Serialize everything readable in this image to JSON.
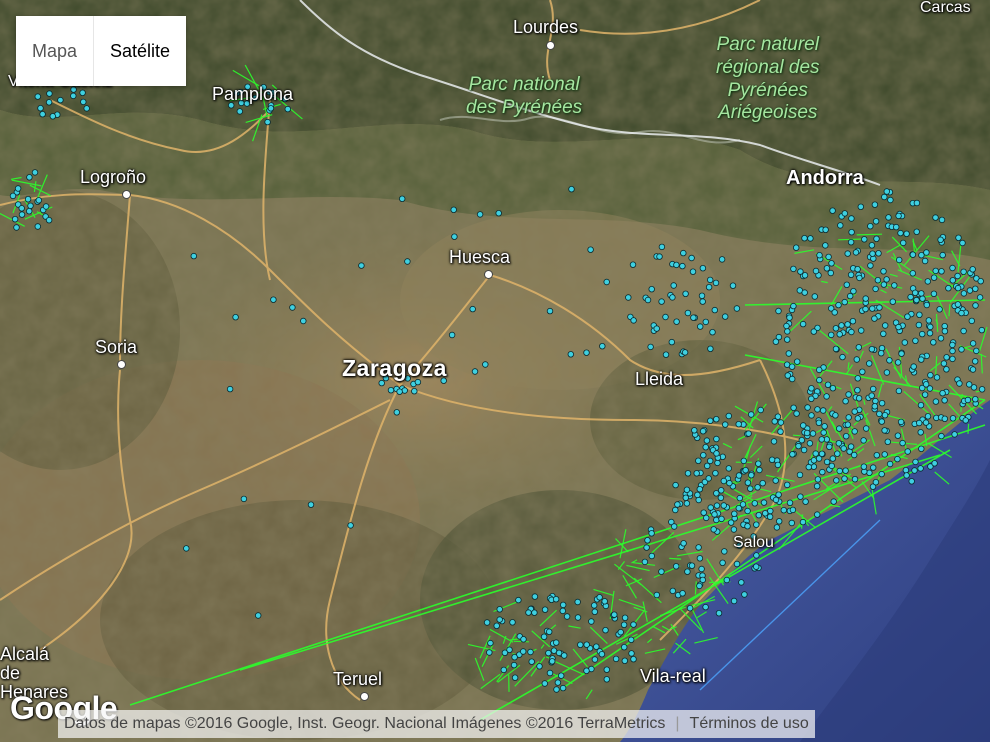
{
  "map_type": {
    "options": [
      "Mapa",
      "Satélite"
    ],
    "active": "Satélite"
  },
  "places": {
    "lourdes": "Lourdes",
    "pamplona": "Pamplona",
    "logrono": "Logroño",
    "andorra": "Andorra",
    "huesca": "Huesca",
    "soria": "Soria",
    "zaragoza": "Zaragoza",
    "lleida": "Lleida",
    "salou": "Salou",
    "teruel": "Teruel",
    "vitoria": "Vitoria-Gasteiz",
    "alcala": "Alcalá de Henares",
    "castellon": "Vila-real",
    "carcas": "Carcas"
  },
  "parks": {
    "pyrenees": [
      "Parc national",
      "des Pyrénées"
    ],
    "ariege": [
      "Parc naturel",
      "régional des",
      "Pyrénées",
      "Ariégeoises"
    ]
  },
  "attribution": {
    "data": "Datos de mapas ©2016 Google, Inst. Geogr. Nacional Imágenes ©2016 TerraMetrics",
    "terms": "Términos de uso"
  },
  "logo": "Google",
  "colors": {
    "marker_fill": "#3fd0e0",
    "marker_stroke": "#0a2a30",
    "track": "#33ff33",
    "sea": "#3c4f96",
    "road": "#e6b86a"
  }
}
